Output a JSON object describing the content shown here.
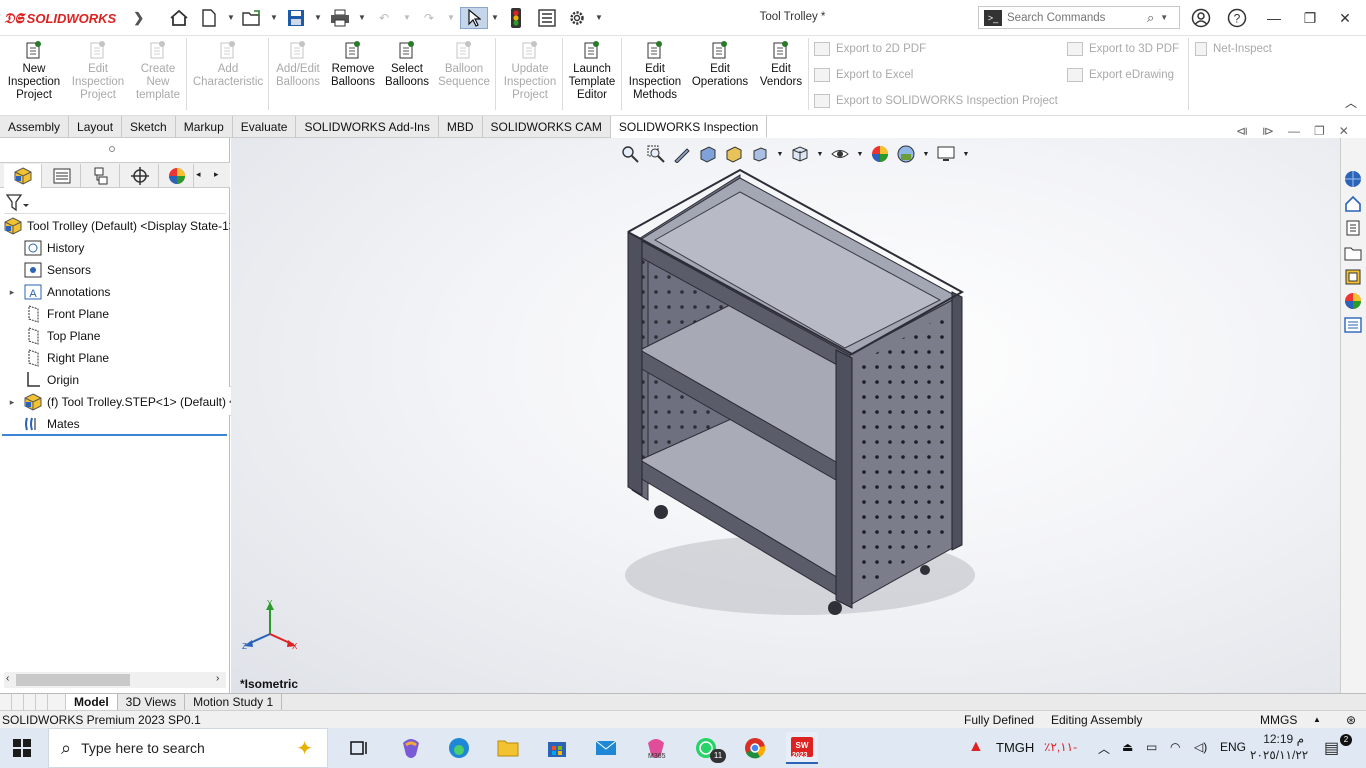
{
  "app": {
    "logo_text": "SOLIDWORKS",
    "window_title": "Tool Trolley *",
    "search_placeholder": "Search Commands"
  },
  "ribbon": {
    "buttons": [
      {
        "label": "New Inspection Project",
        "enabled": true
      },
      {
        "label": "Edit Inspection Project",
        "enabled": false
      },
      {
        "label": "Create New template",
        "enabled": false
      },
      {
        "label": "Add Characteristic",
        "enabled": false
      },
      {
        "label": "Add/Edit Balloons",
        "enabled": false
      },
      {
        "label": "Remove Balloons",
        "enabled": true
      },
      {
        "label": "Select Balloons",
        "enabled": true
      },
      {
        "label": "Balloon Sequence",
        "enabled": false
      },
      {
        "label": "Update Inspection Project",
        "enabled": false
      },
      {
        "label": "Launch Template Editor",
        "enabled": true
      },
      {
        "label": "Edit Inspection Methods",
        "enabled": true
      },
      {
        "label": "Edit Operations",
        "enabled": true
      },
      {
        "label": "Edit Vendors",
        "enabled": true
      }
    ],
    "exports": {
      "export_2d_pdf": "Export to 2D PDF",
      "export_excel": "Export to Excel",
      "export_sw_inspection": "Export to SOLIDWORKS Inspection Project",
      "export_3d_pdf": "Export to 3D PDF",
      "export_edrawing": "Export eDrawing",
      "net_inspect": "Net-Inspect"
    }
  },
  "command_tabs": [
    "Assembly",
    "Layout",
    "Sketch",
    "Markup",
    "Evaluate",
    "SOLIDWORKS Add-Ins",
    "MBD",
    "SOLIDWORKS CAM",
    "SOLIDWORKS Inspection"
  ],
  "active_command_tab": "SOLIDWORKS Inspection",
  "feature_tree": {
    "root": "Tool Trolley (Default) <Display State-1>",
    "items": [
      {
        "label": "History",
        "icon": "history-icon"
      },
      {
        "label": "Sensors",
        "icon": "sensors-icon"
      },
      {
        "label": "Annotations",
        "icon": "annotations-icon"
      },
      {
        "label": "Front Plane",
        "icon": "plane-icon"
      },
      {
        "label": "Top Plane",
        "icon": "plane-icon"
      },
      {
        "label": "Right Plane",
        "icon": "plane-icon"
      },
      {
        "label": "Origin",
        "icon": "origin-icon"
      },
      {
        "label": "(f) Tool Trolley.STEP<1> (Default)",
        "icon": "part-icon"
      },
      {
        "label": "Mates",
        "icon": "mates-icon"
      }
    ]
  },
  "viewport": {
    "view_name": "*Isometric",
    "triad": {
      "x": "X",
      "y": "Y",
      "z": "Z"
    }
  },
  "bottom_tabs": [
    "Model",
    "3D Views",
    "Motion Study 1"
  ],
  "active_bottom_tab": "Model",
  "status": {
    "product": "SOLIDWORKS Premium 2023 SP0.1",
    "definition": "Fully Defined",
    "mode": "Editing Assembly",
    "units": "MMGS"
  },
  "taskbar": {
    "search_placeholder": "Type here to search",
    "whatsapp_badge": "11",
    "m365_label": "M365",
    "sw_badge": "2023",
    "weather_label": "TMGH",
    "weather_value": "٪٢,١١-",
    "language": "ENG",
    "time": "12:19 م",
    "date": "٢٠٢٥/١١/٢٢",
    "notification_count": "2"
  }
}
